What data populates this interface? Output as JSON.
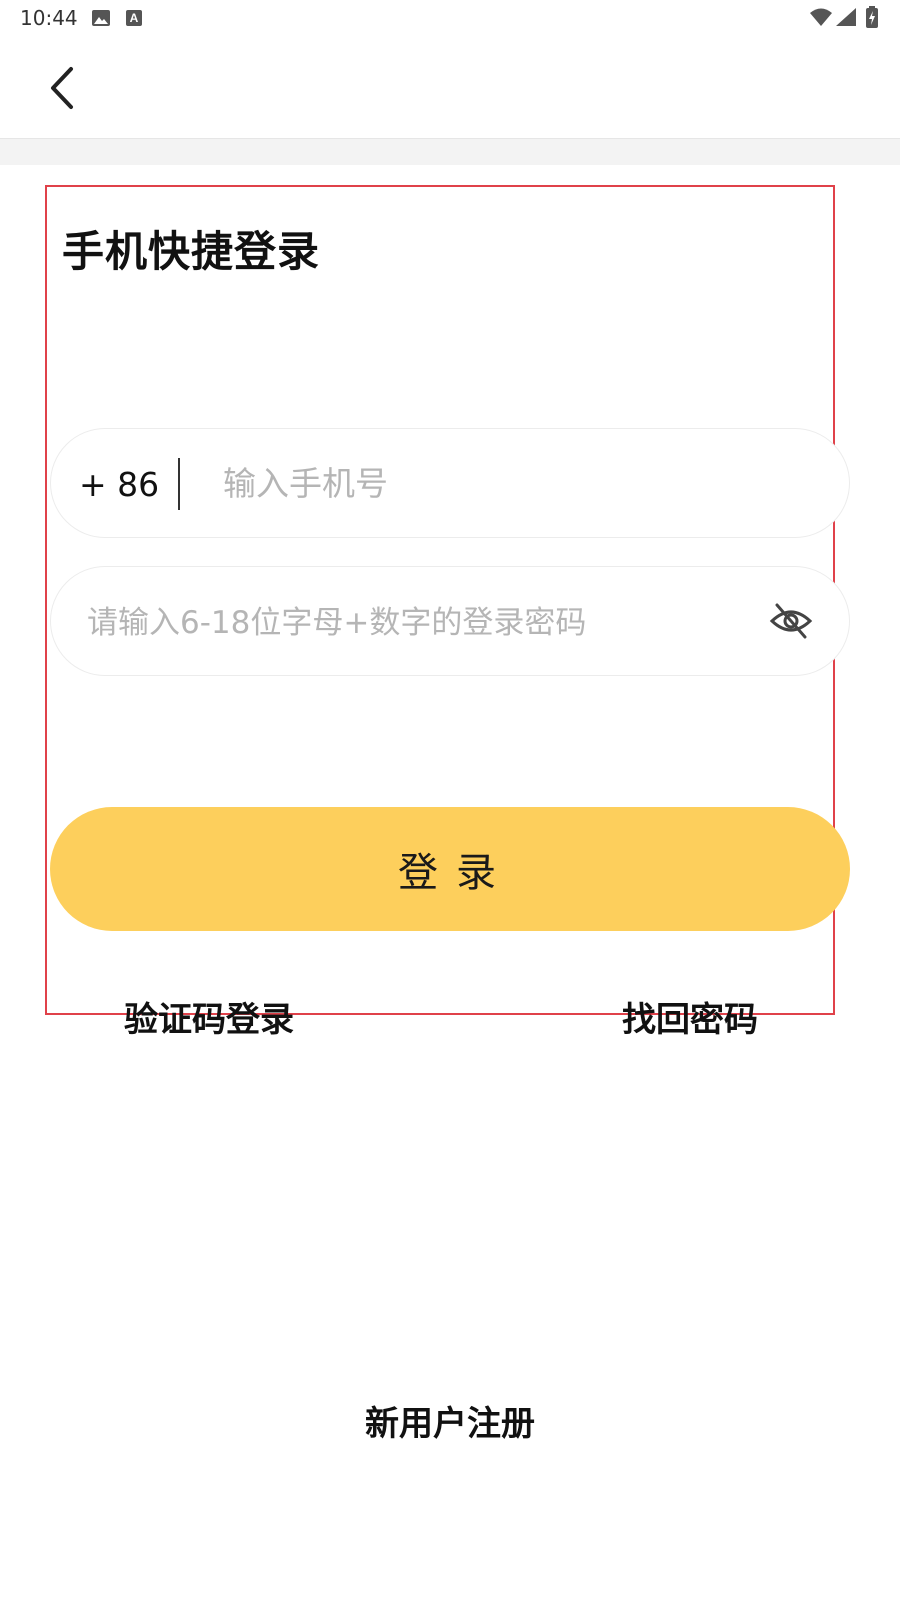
{
  "status_bar": {
    "time": "10:44",
    "icons": [
      "photo-icon",
      "a-icon",
      "wifi-icon",
      "signal-icon",
      "battery-icon"
    ],
    "a_icon_label": "A"
  },
  "nav": {
    "back_icon": "chevron-left-icon"
  },
  "login": {
    "title": "手机快捷登录",
    "country_code": "+ 86",
    "phone_placeholder": "输入手机号",
    "phone_value": "",
    "password_placeholder": "请输入6-18位字母+数字的登录密码",
    "password_value": "",
    "password_visibility_icon": "eye-off-icon",
    "login_button_label": "登录",
    "code_login_link": "验证码登录",
    "find_password_link": "找回密码",
    "register_link": "新用户注册"
  },
  "colors": {
    "accent": "#fdcf5c",
    "highlight_border": "#e0414a",
    "placeholder": "#b5b5b5",
    "field_border": "#ececec",
    "band": "#f3f3f3"
  }
}
